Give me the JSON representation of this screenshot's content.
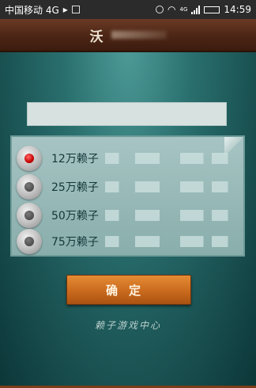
{
  "status_bar": {
    "carrier": "中国移动 4G",
    "signal_label": "4G",
    "time": "14:59",
    "icons": [
      "play-icon",
      "image-icon",
      "alarm-icon",
      "wifi-icon",
      "signal-icon",
      "battery-icon"
    ]
  },
  "header": {
    "title": "沃"
  },
  "options": [
    {
      "label": "12万赖子",
      "selected": true
    },
    {
      "label": "25万赖子",
      "selected": false
    },
    {
      "label": "50万赖子",
      "selected": false
    },
    {
      "label": "75万赖子",
      "selected": false
    }
  ],
  "confirm_label": "确定",
  "footer_text": "赖子游戏中心",
  "colors": {
    "accent": "#c96a1d",
    "title_bar": "#4b2515",
    "background": "#2a706f"
  }
}
